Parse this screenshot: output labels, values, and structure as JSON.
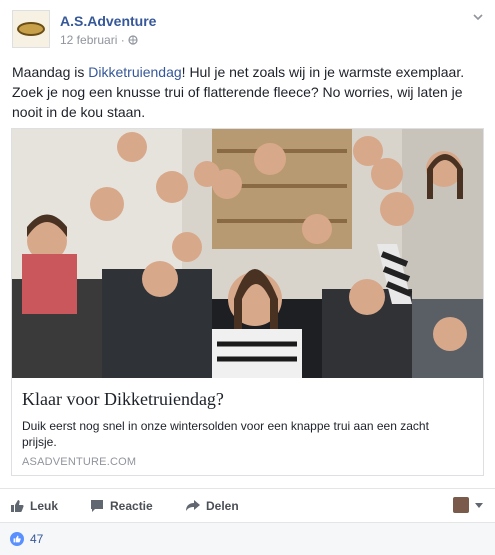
{
  "post": {
    "page_name": "A.S.Adventure",
    "date": "12 februari",
    "separator": "·",
    "text_before": "Maandag is ",
    "hashtag": "Dikketruiendag",
    "text_after": "! Hul je net zoals wij in je warmste exemplaar. Zoek je nog een knusse trui of flatterende fleece? No worries, wij laten je nooit in de kou staan."
  },
  "link_card": {
    "title": "Klaar voor Dikketruiendag?",
    "description": "Duik eerst nog snel in onze wintersolden voor een knappe trui aan een zacht prijsje.",
    "domain": "ASADVENTURE.COM"
  },
  "actions": {
    "like": "Leuk",
    "comment": "Reactie",
    "share": "Delen"
  },
  "reactions": {
    "count": "47"
  },
  "icons": [
    "page-avatar-icon",
    "globe-icon",
    "chevron-down-icon",
    "like-icon",
    "comment-icon",
    "share-icon",
    "like-reaction-icon"
  ],
  "colors": {
    "link": "#365899",
    "like_blue": "#5890ff"
  }
}
